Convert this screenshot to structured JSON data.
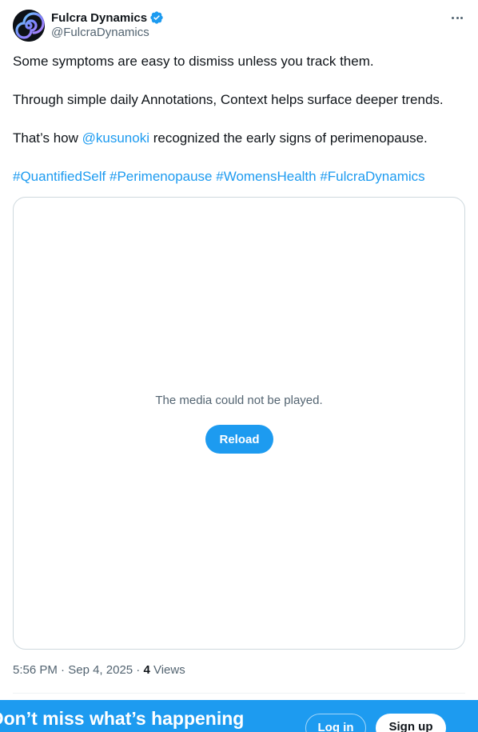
{
  "author": {
    "display_name": "Fulcra Dynamics",
    "handle": "@FulcraDynamics",
    "verified": true,
    "avatar_icon": "spiral-logo-icon"
  },
  "post": {
    "line1": "Some symptoms are easy to dismiss unless you track them.",
    "line2": "Through simple daily Annotations, Context helps surface deeper trends.",
    "line3_before": "That’s how ",
    "mention": "@kusunoki",
    "line3_after": " recognized the early signs of perimenopause.",
    "hashtags": [
      "#QuantifiedSelf",
      "#Perimenopause",
      "#WomensHealth",
      "#FulcraDynamics"
    ]
  },
  "media": {
    "error_message": "The media could not be played.",
    "reload_label": "Reload"
  },
  "meta": {
    "time": "5:56 PM",
    "separator": "·",
    "date": "Sep 4, 2025",
    "views_count": "4",
    "views_label": "Views"
  },
  "banner": {
    "title": "Don’t miss what’s happening",
    "login_label": "Log in",
    "signup_label": "Sign up"
  },
  "colors": {
    "accent": "#1d9bf0",
    "text_primary": "#0f1419",
    "text_secondary": "#536471",
    "border": "#cfd9de"
  }
}
